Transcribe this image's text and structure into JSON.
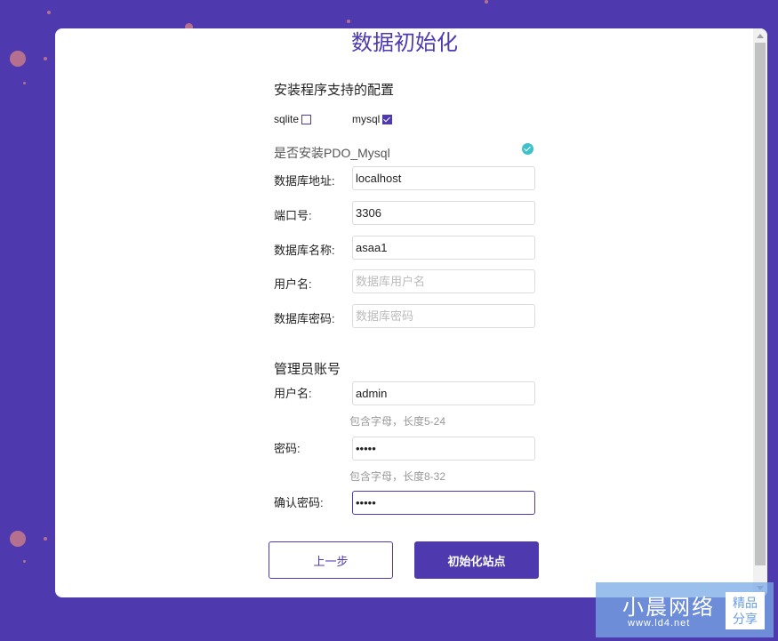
{
  "page": {
    "title": "数据初始化",
    "accent_color": "#4e3aae"
  },
  "install_config": {
    "title": "安装程序支持的配置",
    "options": [
      {
        "label": "sqlite",
        "checked": false
      },
      {
        "label": "mysql",
        "checked": true
      }
    ],
    "pdo_label": "是否安装PDO_Mysql",
    "pdo_status_icon": "check-circle-icon",
    "fields": [
      {
        "label": "数据库地址:",
        "value": "localhost",
        "placeholder": ""
      },
      {
        "label": "端口号:",
        "value": "3306",
        "placeholder": ""
      },
      {
        "label": "数据库名称:",
        "value": "asaa1",
        "placeholder": ""
      },
      {
        "label": "用户名:",
        "value": "",
        "placeholder": "数据库用户名"
      },
      {
        "label": "数据库密码:",
        "value": "",
        "placeholder": "数据库密码"
      }
    ]
  },
  "admin": {
    "title": "管理员账号",
    "username": {
      "label": "用户名:",
      "value": "admin",
      "hint": "包含字母，长度5-24"
    },
    "password": {
      "label": "密码:",
      "value": "•••••",
      "hint": "包含字母，长度8-32"
    },
    "confirm": {
      "label": "确认密码:",
      "value": "•••••"
    }
  },
  "buttons": {
    "prev": "上一步",
    "init": "初始化站点"
  },
  "watermark": {
    "main": "小晨网络",
    "sub": "www.ld4.net",
    "badge_line1": "精品",
    "badge_line2": "分享"
  }
}
